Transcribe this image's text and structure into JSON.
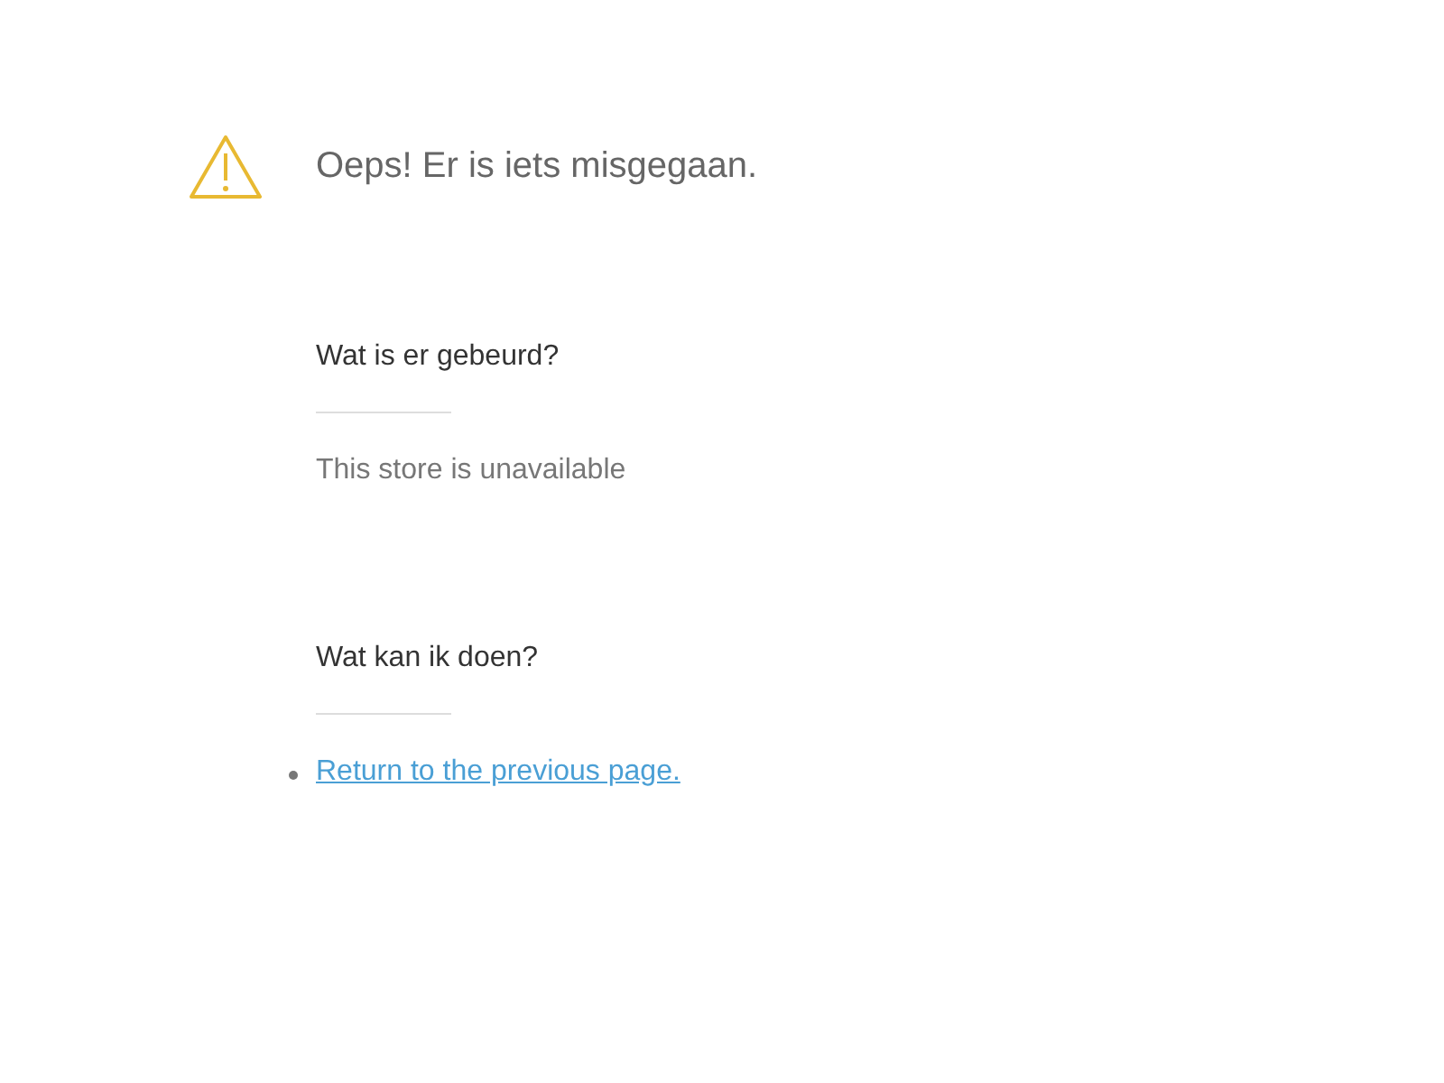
{
  "title": "Oeps! Er is iets misgegaan.",
  "sections": [
    {
      "heading": "Wat is er gebeurd?",
      "kind": "text",
      "text": "This store is unavailable"
    },
    {
      "heading": "Wat kan ik doen?",
      "kind": "links",
      "links": [
        "Return to the previous page."
      ]
    }
  ]
}
